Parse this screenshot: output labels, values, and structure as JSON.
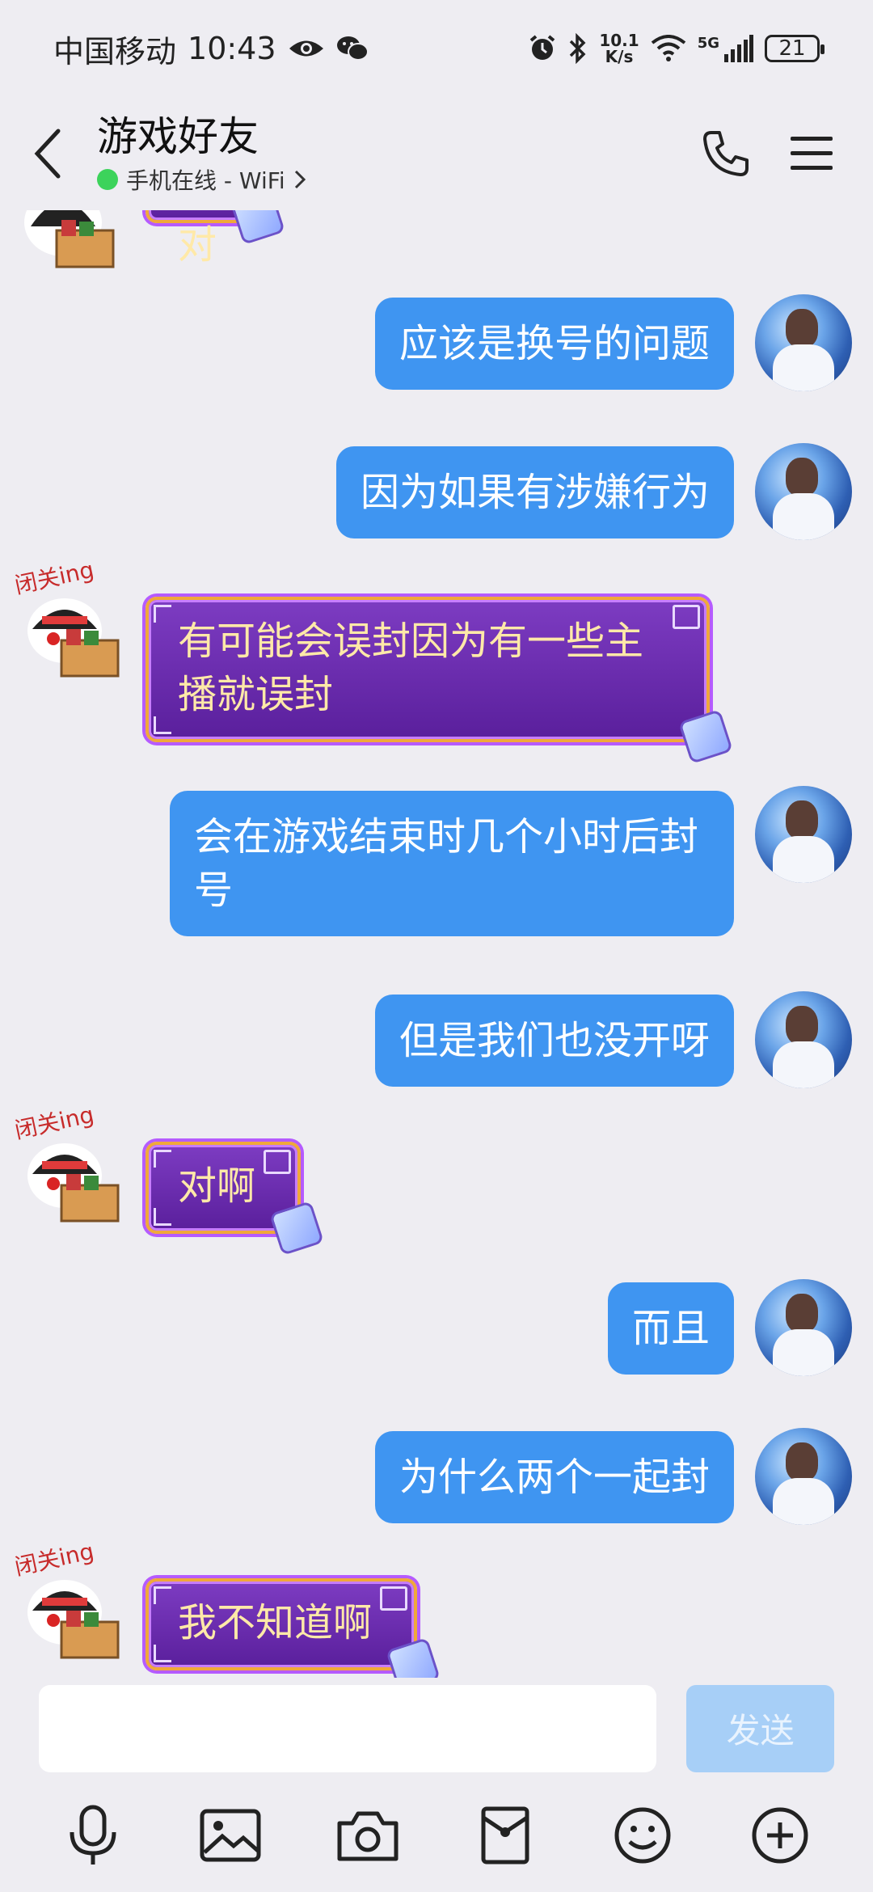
{
  "status_bar": {
    "carrier": "中国移动",
    "time": "10:43",
    "net_speed_value": "10.1",
    "net_speed_unit": "K/s",
    "signal_label": "5G",
    "battery": "21"
  },
  "header": {
    "title": "游戏好友",
    "status": "手机在线 - WiFi"
  },
  "messages": [
    {
      "side": "left",
      "text": "不对"
    },
    {
      "side": "right",
      "text": "应该是换号的问题"
    },
    {
      "side": "right",
      "text": "因为如果有涉嫌行为"
    },
    {
      "side": "left",
      "text": "有可能会误封因为有一些主播就误封"
    },
    {
      "side": "right",
      "text": "会在游戏结束时几个小时后封号"
    },
    {
      "side": "right",
      "text": "但是我们也没开呀"
    },
    {
      "side": "left",
      "text": "对啊"
    },
    {
      "side": "right",
      "text": "而且"
    },
    {
      "side": "right",
      "text": "为什么两个一起封"
    },
    {
      "side": "left",
      "text": "我不知道啊"
    }
  ],
  "sticker_text": "闭关ing",
  "input": {
    "value": "",
    "send_label": "发送"
  },
  "toolbar_icons": [
    "microphone-icon",
    "image-icon",
    "camera-icon",
    "red-packet-icon",
    "emoji-icon",
    "plus-icon"
  ],
  "colors": {
    "background": "#eeedf2",
    "outgoing_bubble": "#3f95f1",
    "incoming_bubble": "#6a2db0",
    "incoming_text": "#ffe9a8",
    "send_button": "#a7cff7",
    "online_dot": "#3cd35b"
  }
}
